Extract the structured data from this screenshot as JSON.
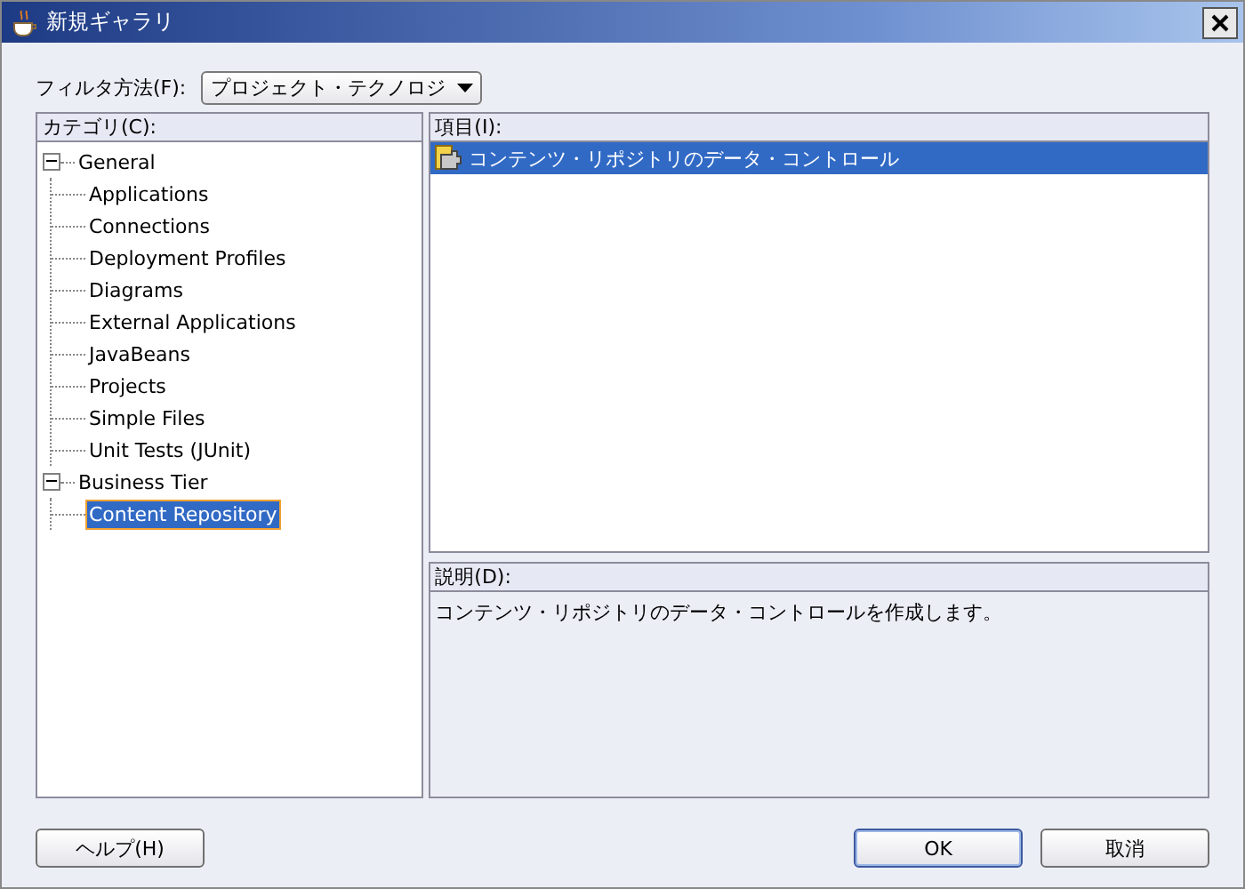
{
  "window": {
    "title": "新規ギャラリ"
  },
  "filter": {
    "label": "フィルタ方法(F):",
    "value": "プロジェクト・テクノロジ"
  },
  "categories": {
    "label": "カテゴリ(C):",
    "tree": [
      {
        "label": "General",
        "expanded": true,
        "selected": false,
        "children": [
          {
            "label": "Applications",
            "selected": false
          },
          {
            "label": "Connections",
            "selected": false
          },
          {
            "label": "Deployment Profiles",
            "selected": false
          },
          {
            "label": "Diagrams",
            "selected": false
          },
          {
            "label": "External Applications",
            "selected": false
          },
          {
            "label": "JavaBeans",
            "selected": false
          },
          {
            "label": "Projects",
            "selected": false
          },
          {
            "label": "Simple Files",
            "selected": false
          },
          {
            "label": "Unit Tests (JUnit)",
            "selected": false
          }
        ]
      },
      {
        "label": "Business Tier",
        "expanded": true,
        "selected": false,
        "children": [
          {
            "label": "Content Repository",
            "selected": true
          }
        ]
      }
    ]
  },
  "items": {
    "label": "項目(I):",
    "rows": [
      {
        "label": "コンテンツ・リポジトリのデータ・コントロール",
        "selected": true
      }
    ]
  },
  "description": {
    "label": "説明(D):",
    "text": "コンテンツ・リポジトリのデータ・コントロールを作成します。"
  },
  "buttons": [
    {
      "label": "ヘルプ(H)",
      "kind": "help",
      "default": false
    },
    {
      "label": "OK",
      "kind": "ok",
      "default": true
    },
    {
      "label": "取消",
      "kind": "cancel",
      "default": false
    }
  ]
}
